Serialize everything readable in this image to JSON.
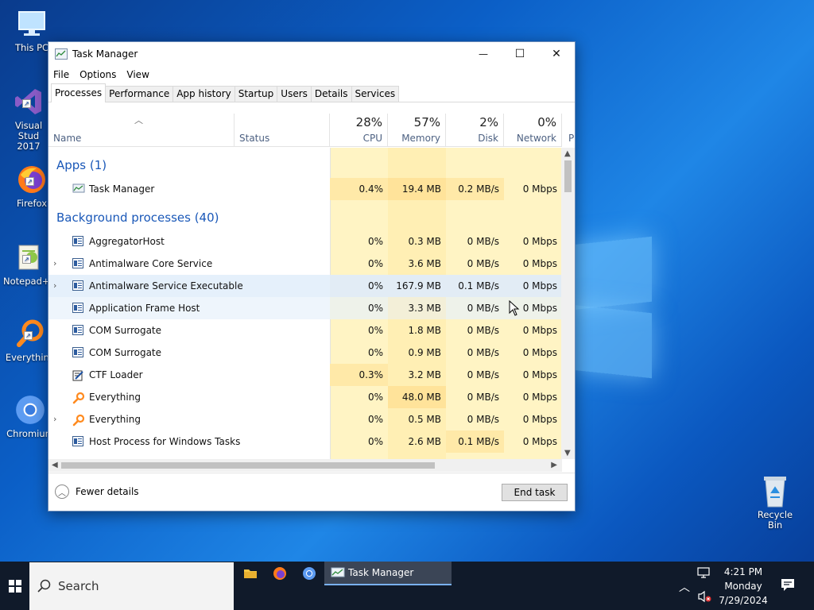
{
  "desktop": {
    "icons": [
      {
        "label": "This PC",
        "icon": "computer-icon"
      },
      {
        "label": "Visual Studio 2017",
        "line1": "Visual Stud",
        "line2": "2017",
        "icon": "visual-studio-icon"
      },
      {
        "label": "Firefox",
        "icon": "firefox-icon"
      },
      {
        "label": "Notepad++",
        "icon": "notepadpp-icon"
      },
      {
        "label": "Everything",
        "icon": "everything-icon"
      },
      {
        "label": "Chromium",
        "icon": "chromium-icon"
      },
      {
        "label": "Recycle Bin",
        "icon": "recycle-bin-icon"
      }
    ]
  },
  "window": {
    "title": "Task Manager",
    "controls": {
      "minimize": "—",
      "maximize": "☐",
      "close": "✕"
    }
  },
  "menu": [
    "File",
    "Options",
    "View"
  ],
  "tabs": [
    "Processes",
    "Performance",
    "App history",
    "Startup",
    "Users",
    "Details",
    "Services"
  ],
  "active_tab": "Processes",
  "columns": {
    "name": "Name",
    "status": "Status",
    "cpu": {
      "pct": "28%",
      "label": "CPU"
    },
    "memory": {
      "pct": "57%",
      "label": "Memory"
    },
    "disk": {
      "pct": "2%",
      "label": "Disk"
    },
    "network": {
      "pct": "0%",
      "label": "Network"
    },
    "power": "P"
  },
  "groups": {
    "apps": "Apps (1)",
    "background": "Background processes (40)"
  },
  "apps": [
    {
      "name": "Task Manager",
      "cpu": "0.4%",
      "memory": "19.4 MB",
      "disk": "0.2 MB/s",
      "network": "0 Mbps"
    }
  ],
  "background": [
    {
      "name": "AggregatorHost",
      "cpu": "0%",
      "memory": "0.3 MB",
      "disk": "0 MB/s",
      "network": "0 Mbps",
      "expandable": false,
      "icon": "app-icon"
    },
    {
      "name": "Antimalware Core Service",
      "cpu": "0%",
      "memory": "3.6 MB",
      "disk": "0 MB/s",
      "network": "0 Mbps",
      "expandable": true,
      "icon": "app-icon"
    },
    {
      "name": "Antimalware Service Executable",
      "cpu": "0%",
      "memory": "167.9 MB",
      "disk": "0.1 MB/s",
      "network": "0 Mbps",
      "expandable": true,
      "icon": "app-icon"
    },
    {
      "name": "Application Frame Host",
      "cpu": "0%",
      "memory": "3.3 MB",
      "disk": "0 MB/s",
      "network": "0 Mbps",
      "expandable": false,
      "icon": "app-icon"
    },
    {
      "name": "COM Surrogate",
      "cpu": "0%",
      "memory": "1.8 MB",
      "disk": "0 MB/s",
      "network": "0 Mbps",
      "expandable": false,
      "icon": "app-icon"
    },
    {
      "name": "COM Surrogate",
      "cpu": "0%",
      "memory": "0.9 MB",
      "disk": "0 MB/s",
      "network": "0 Mbps",
      "expandable": false,
      "icon": "app-icon"
    },
    {
      "name": "CTF Loader",
      "cpu": "0.3%",
      "memory": "3.2 MB",
      "disk": "0 MB/s",
      "network": "0 Mbps",
      "expandable": false,
      "icon": "ctf-loader-icon"
    },
    {
      "name": "Everything",
      "cpu": "0%",
      "memory": "48.0 MB",
      "disk": "0 MB/s",
      "network": "0 Mbps",
      "expandable": false,
      "icon": "everything-icon"
    },
    {
      "name": "Everything",
      "cpu": "0%",
      "memory": "0.5 MB",
      "disk": "0 MB/s",
      "network": "0 Mbps",
      "expandable": true,
      "icon": "everything-icon"
    },
    {
      "name": "Host Process for Windows Tasks",
      "cpu": "0%",
      "memory": "2.6 MB",
      "disk": "0.1 MB/s",
      "network": "0 Mbps",
      "expandable": false,
      "icon": "app-icon"
    }
  ],
  "footer": {
    "fewer_details": "Fewer details",
    "end_task": "End task"
  },
  "taskbar": {
    "search_placeholder": "Search",
    "active_task": "Task Manager",
    "time": "4:21 PM",
    "day": "Monday",
    "date": "7/29/2024"
  }
}
